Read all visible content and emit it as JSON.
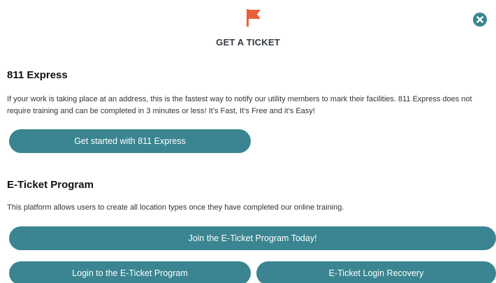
{
  "modal": {
    "title": "GET A TICKET",
    "flag_icon": "flag-icon",
    "close_icon": "close-icon",
    "accent_color": "#3a8591",
    "flag_color": "#e8613c"
  },
  "express": {
    "heading": "811 Express",
    "description": "If your work is taking place at an address, this is the fastest way to notify our utility members to mark their facilities. 811 Express does not require training and can be completed in 3 minutes or less! It’s Fast, It’s Free and it’s Easy!",
    "button_label": "Get started with 811 Express"
  },
  "eticket": {
    "heading": "E-Ticket Program",
    "description": "This platform allows users to create all location types once they have completed our online training.",
    "join_label": "Join the E-Ticket Program Today!",
    "login_label": "Login to the E-Ticket Program",
    "recovery_label": "E-Ticket Login Recovery"
  }
}
